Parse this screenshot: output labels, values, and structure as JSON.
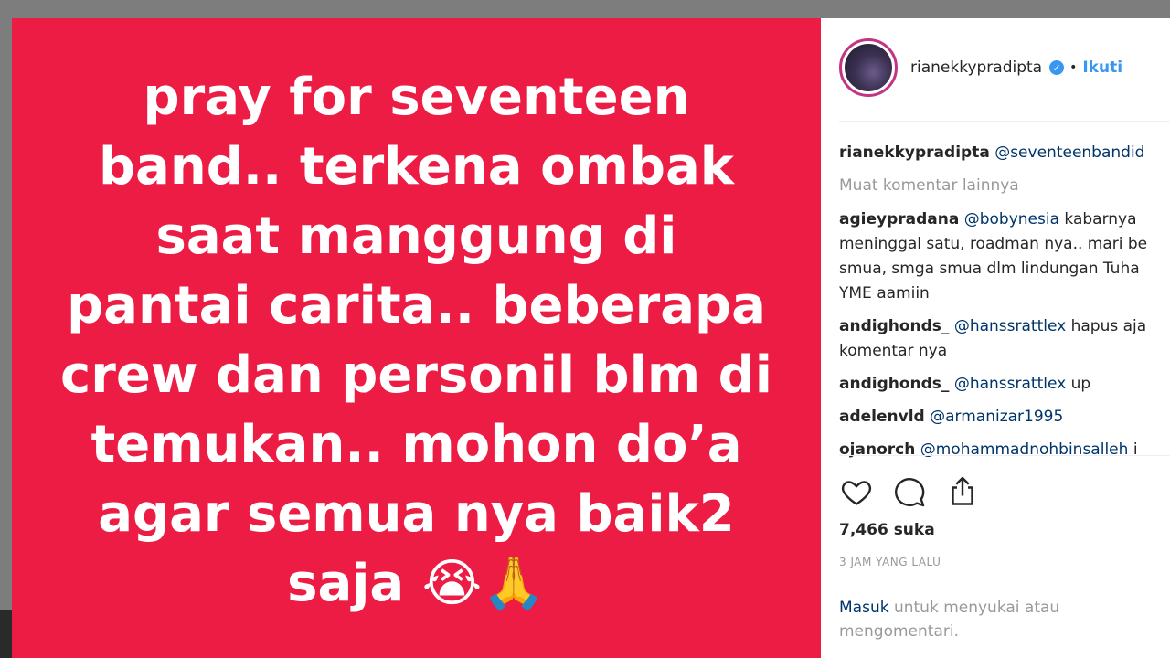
{
  "media": {
    "lines": [
      "pray for seventeen",
      "band.. terkena ombak",
      "saat manggung di",
      "pantai carita.. beberapa",
      "crew dan personil blm di",
      "temukan.. mohon do’a",
      "agar semua nya baik2",
      "saja 😭🙏"
    ],
    "background": "#ec1c44"
  },
  "header": {
    "username": "rianekkypradipta",
    "verified_icon": "verified-badge-icon",
    "separator": "•",
    "follow_label": "Ikuti"
  },
  "comments": {
    "caption": {
      "user": "rianekkypradipta",
      "text": "@seventeenbandid"
    },
    "load_more": "Muat komentar lainnya",
    "items": [
      {
        "user": "agieypradana",
        "mention": "@bobynesia",
        "text": " kabarnya meninggal satu, roadman nya.. mari be smua, smga smua dlm lindungan Tuha YME aamiin"
      },
      {
        "user": "andighonds_",
        "mention": "@hanssrattlex",
        "text": " hapus aja komentar nya"
      },
      {
        "user": "andighonds_",
        "mention": "@hanssrattlex",
        "text": " up"
      },
      {
        "user": "adelenvld",
        "mention": "@armanizar1995",
        "text": ""
      },
      {
        "user": "ojanorch",
        "mention": "@mohammadnohbinsalleh",
        "text": " i"
      }
    ]
  },
  "actions": {
    "like_icon": "heart-icon",
    "comment_icon": "comment-icon",
    "share_icon": "share-icon"
  },
  "likes": "7,466 suka",
  "timestamp": "3 JAM YANG LALU",
  "login": {
    "link": "Masuk",
    "text": " untuk menyukai atau mengomentari."
  },
  "colors": {
    "accent": "#3897f0",
    "mention": "#003569",
    "muted": "#999999"
  }
}
